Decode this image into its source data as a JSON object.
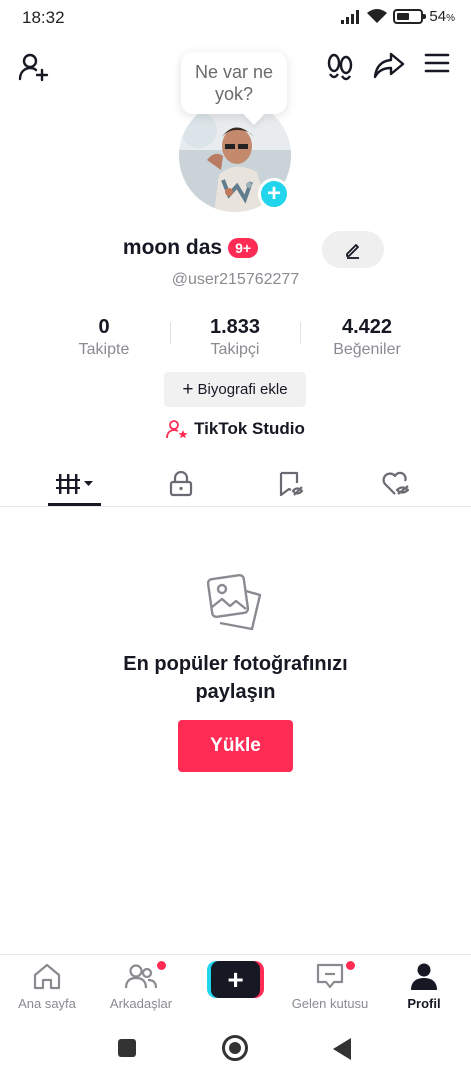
{
  "status_bar": {
    "time": "18:32",
    "battery": "54",
    "battery_unit": "%",
    "battery_level": 0.54
  },
  "bubble": {
    "line1": "Ne var ne",
    "line2": "yok?"
  },
  "profile": {
    "name": "moon das",
    "badge": "9+",
    "handle": "@user215762277",
    "stats": [
      {
        "value": "0",
        "label": "Takipte"
      },
      {
        "value": "1.833",
        "label": "Takipçi"
      },
      {
        "value": "4.422",
        "label": "Beğeniler"
      }
    ],
    "bio_button": "Biyografi ekle",
    "studio_label": "TikTok Studio"
  },
  "tabs": [
    "videos-grid-icon",
    "lock-icon",
    "bookmark-icon",
    "heart-hidden-icon"
  ],
  "empty_state": {
    "title_line1": "En popüler fotoğrafınızı",
    "title_line2": "paylaşın",
    "upload_label": "Yükle"
  },
  "nav": {
    "home": "Ana sayfa",
    "friends": "Arkadaşlar",
    "create": "+",
    "inbox": "Gelen kutusu",
    "profile": "Profil"
  },
  "colors": {
    "accent": "#fe2c55",
    "cyan": "#20d5ec",
    "text": "#161823",
    "muted": "#8a8b91"
  }
}
